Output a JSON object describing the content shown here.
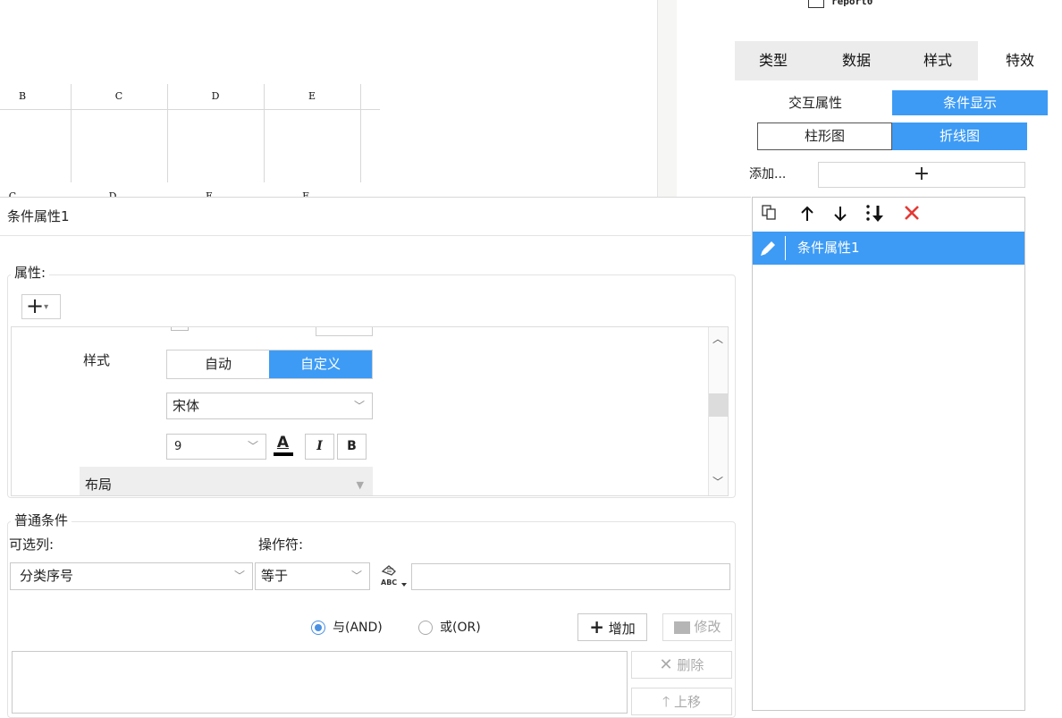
{
  "sheet": {
    "columns": [
      "B",
      "C",
      "D",
      "E"
    ],
    "next_row_partial": [
      "C",
      "D",
      "E",
      "F"
    ]
  },
  "tree": {
    "report_label": "report0"
  },
  "right_tabs": [
    "类型",
    "数据",
    "样式",
    "特效"
  ],
  "interaction_tabs": {
    "left": "交互属性",
    "right": "条件显示"
  },
  "chart_tabs": {
    "left": "柱形图",
    "right": "折线图"
  },
  "add_row": {
    "label": "添加...",
    "plus": "+"
  },
  "list_toolbar": {
    "copy_icon": "copy-icon",
    "up_icon": "arrow-up-icon",
    "down_icon": "arrow-down-icon",
    "move_bottom_icon": "move-to-bottom-icon",
    "delete_icon": "delete-x-icon"
  },
  "list_items": [
    {
      "label": "条件属性1",
      "icon": "pencil-icon"
    }
  ],
  "dialog": {
    "name": "条件属性1",
    "attr_group_label": "属性:",
    "add_attr": "+",
    "style_label": "样式",
    "style_modes": {
      "auto": "自动",
      "custom": "自定义"
    },
    "font_family": "宋体",
    "font_size": "9",
    "font_buttons": {
      "color": "A",
      "italic": "I",
      "bold": "B"
    },
    "layout_label": "布局",
    "cond_group_label": "普通条件",
    "column_label": "可选列:",
    "column_value": "分类序号",
    "operator_label": "操作符:",
    "operator_value": "等于",
    "value_type_icon": "abc-formula-icon",
    "value_input": "",
    "logic_and": "与(AND)",
    "logic_or": "或(OR)",
    "add_btn": "增加",
    "modify_btn": "修改",
    "delete_btn": "删除",
    "move_up_btn": "上移"
  },
  "colors": {
    "accent": "#3d9bf5",
    "delete": "#e53935",
    "tab_bg": "#ececec"
  }
}
